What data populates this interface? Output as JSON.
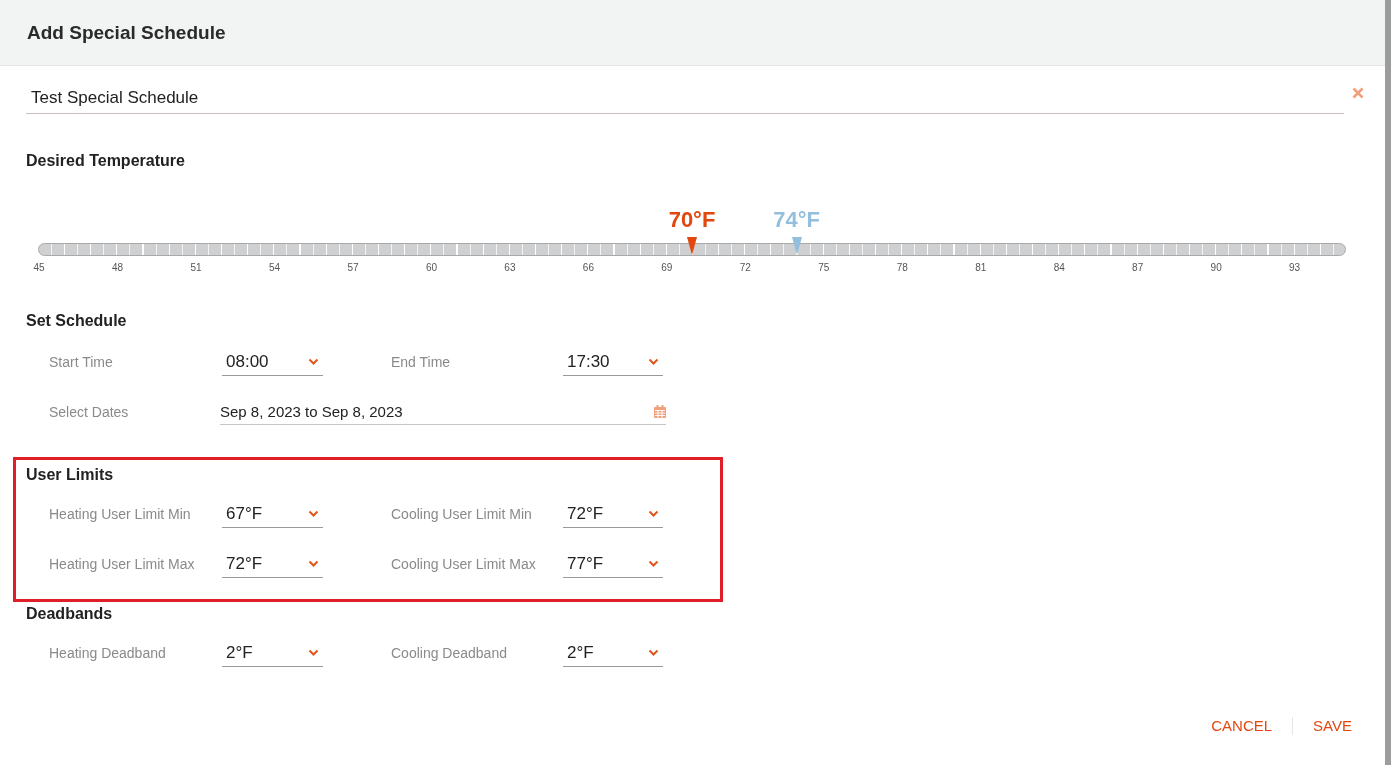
{
  "dialog": {
    "title": "Add Special Schedule"
  },
  "name_field": {
    "value": "Test Special Schedule"
  },
  "desired_temperature": {
    "heading": "Desired Temperature",
    "heat_setpoint": {
      "reading": "70°F",
      "level": 0.5
    },
    "cool_setpoint": {
      "reading": "74°F",
      "level": 0.58
    },
    "scale_labels": [
      "45",
      "48",
      "51",
      "54",
      "57",
      "60",
      "63",
      "66",
      "69",
      "72",
      "75",
      "78",
      "81",
      "84",
      "87",
      "90",
      "93"
    ]
  },
  "set_schedule": {
    "heading": "Set Schedule",
    "fields": [
      {
        "label": "Start Time",
        "value": "08:00"
      },
      {
        "label": "End Time",
        "value": "17:30"
      }
    ],
    "dates": {
      "label": "Select Dates",
      "value": "Sep 8, 2023 to Sep 8, 2023"
    }
  },
  "user_limits": {
    "heading": "User Limits",
    "highlighted": true,
    "fields": [
      {
        "label": "Heating User Limit Min",
        "value": "67°F"
      },
      {
        "label": "Cooling User Limit Min",
        "value": "72°F"
      },
      {
        "label": "Heating User Limit Max",
        "value": "72°F"
      },
      {
        "label": "Cooling User Limit Max",
        "value": "77°F"
      }
    ]
  },
  "deadbands": {
    "heading": "Deadbands",
    "fields": [
      {
        "label": "Heating Deadband",
        "value": "2°F"
      },
      {
        "label": "Cooling Deadband",
        "value": "2°F"
      }
    ]
  },
  "buttons": [
    {
      "label": "CANCEL"
    },
    {
      "label": "SAVE"
    }
  ]
}
